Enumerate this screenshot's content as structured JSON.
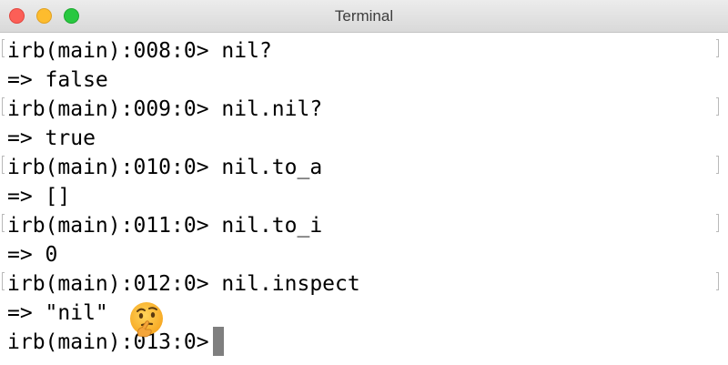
{
  "window": {
    "title": "Terminal"
  },
  "terminal": {
    "lines": [
      "irb(main):008:0> nil?",
      "=> false",
      "irb(main):009:0> nil.nil?",
      "=> true",
      "irb(main):010:0> nil.to_a",
      "=> []",
      "irb(main):011:0> nil.to_i",
      "=> 0",
      "irb(main):012:0> nil.inspect",
      "=> \"nil\"",
      "irb(main):013:0> "
    ],
    "emoji": "thinking-face-emoji",
    "cursor": "block-cursor"
  },
  "colors": {
    "close": "#fc5f57",
    "minimize": "#fdbc2e",
    "zoom": "#28c840",
    "cursor": "#7f7f7f",
    "text": "#000000"
  }
}
